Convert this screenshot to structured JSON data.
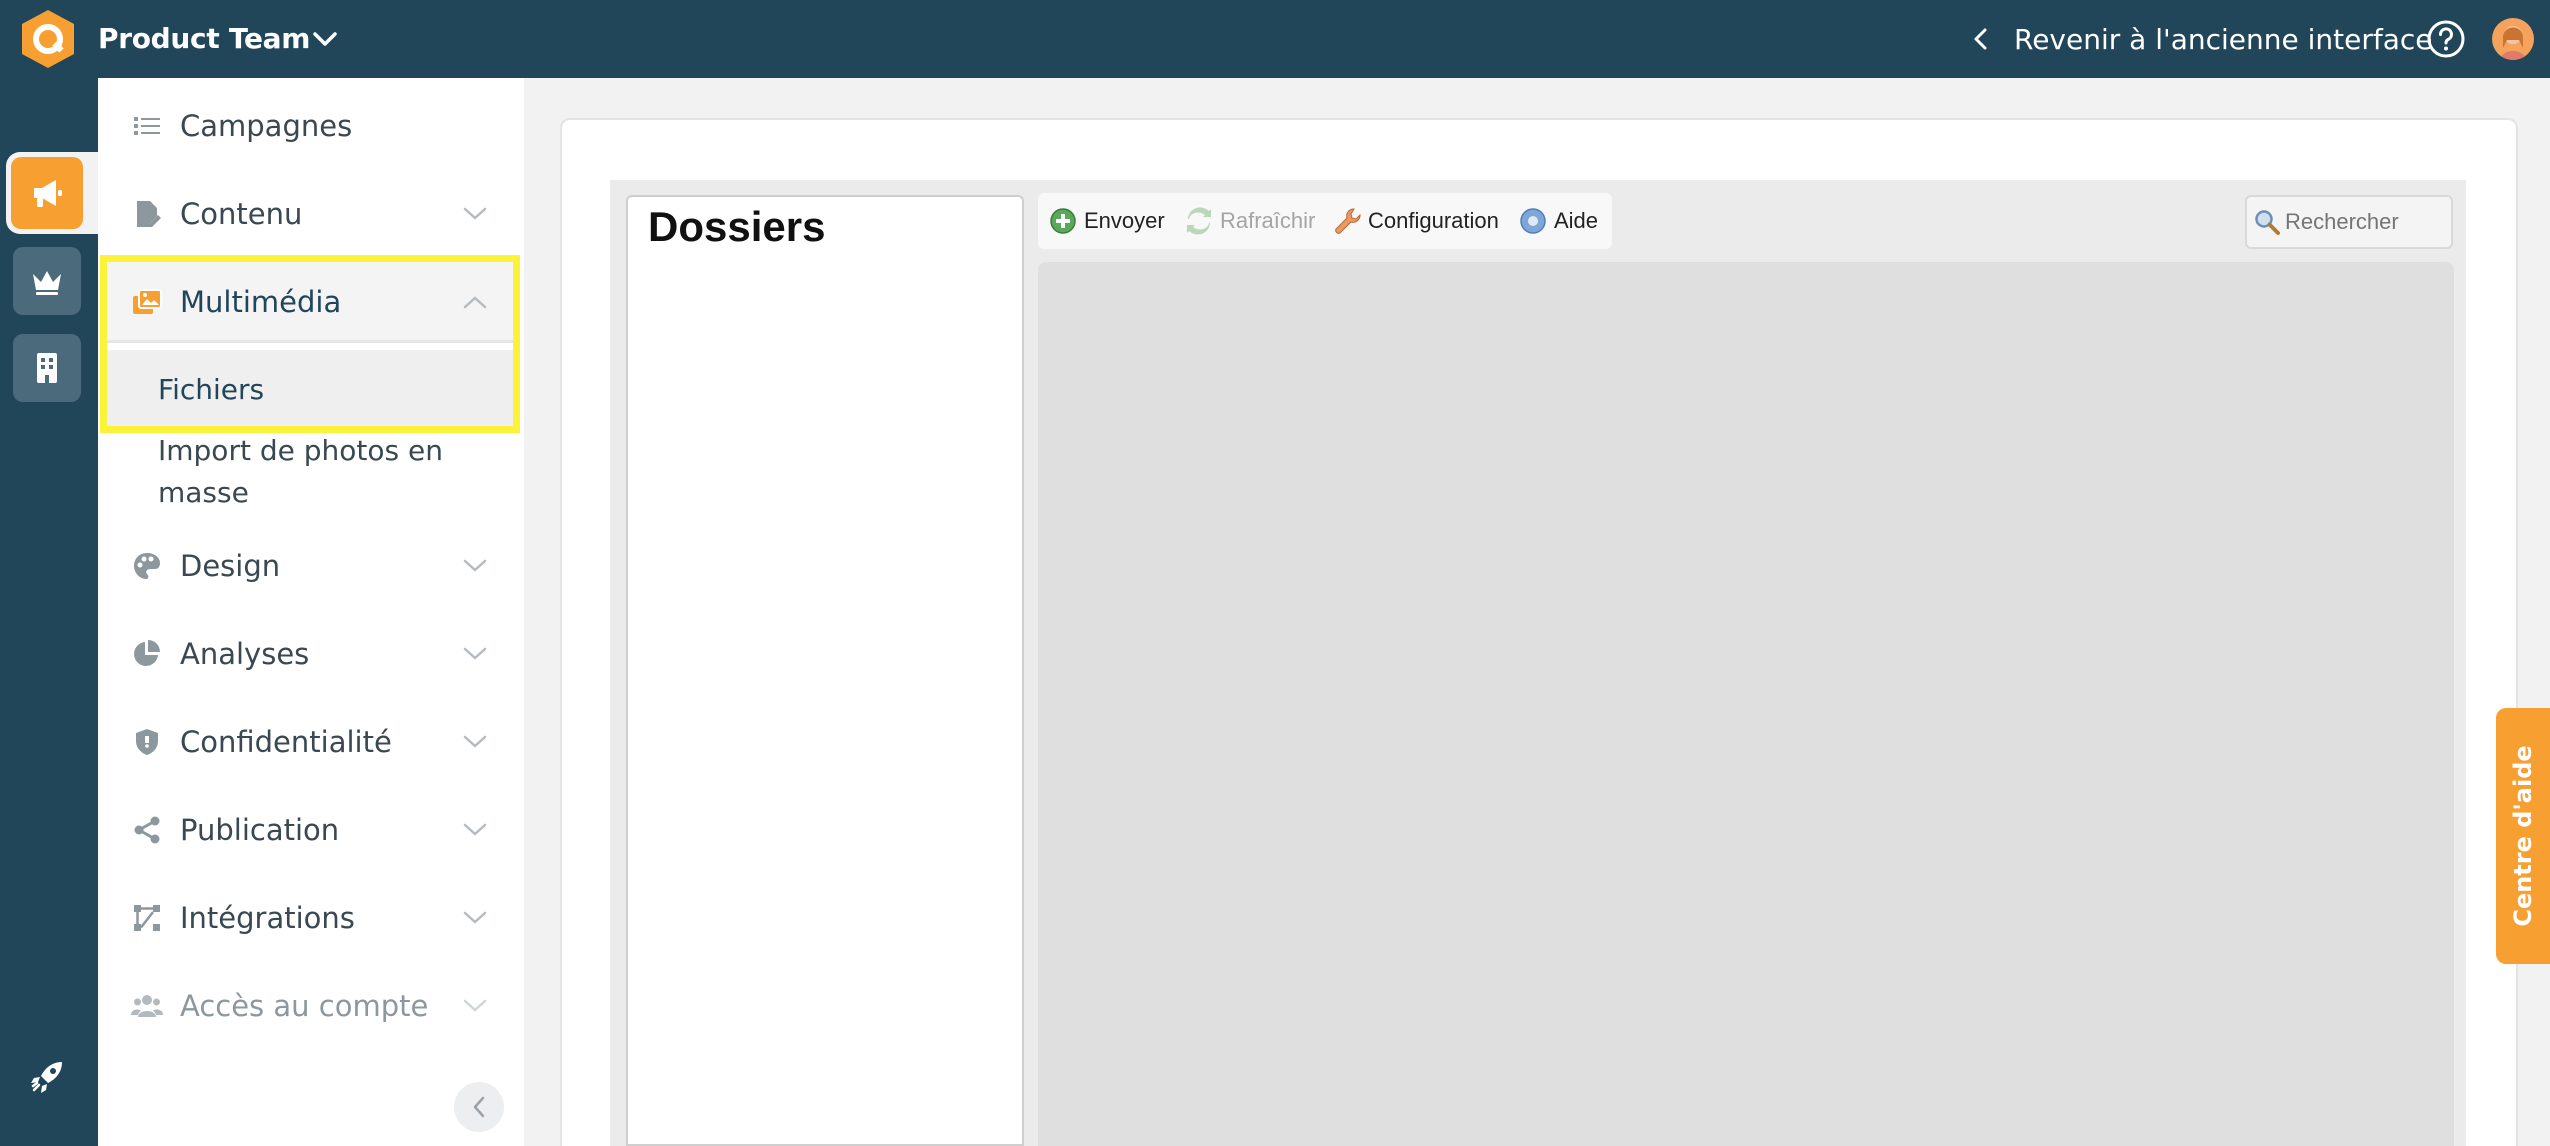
{
  "header": {
    "team_name": "Product Team",
    "back_link": "Revenir à l'ancienne interface"
  },
  "sidebar": {
    "items": [
      {
        "label": "Campagnes"
      },
      {
        "label": "Contenu"
      },
      {
        "label": "Multimédia"
      },
      {
        "label": "Design"
      },
      {
        "label": "Analyses"
      },
      {
        "label": "Confidentialité"
      },
      {
        "label": "Publication"
      },
      {
        "label": "Intégrations"
      },
      {
        "label": "Accès au compte"
      }
    ],
    "multimedia_subitems": [
      {
        "label": "Fichiers"
      },
      {
        "label": "Import de photos en masse"
      }
    ]
  },
  "file_manager": {
    "tree_title": "Dossiers",
    "toolbar": {
      "upload": "Envoyer",
      "refresh": "Rafraîchir",
      "config": "Configuration",
      "help": "Aide"
    },
    "search_placeholder": "Rechercher"
  },
  "help_tab": {
    "label": "Centre d'aide"
  },
  "colors": {
    "nav_bg": "#21465a",
    "accent": "#f7a031",
    "highlight": "#fbf23a"
  }
}
